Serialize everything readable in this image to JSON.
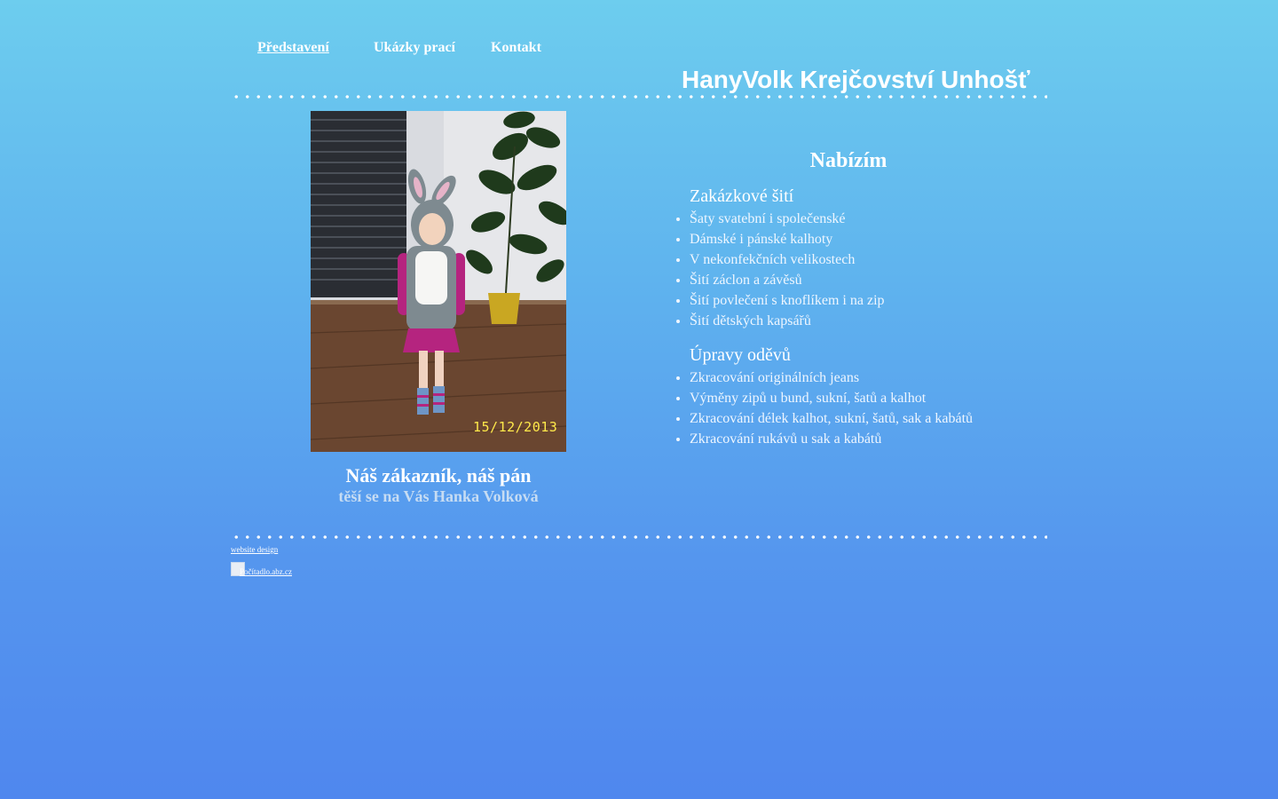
{
  "nav": {
    "items": [
      {
        "label": "Představení",
        "active": true
      },
      {
        "label": "Ukázky prací",
        "active": false
      },
      {
        "label": "Kontakt",
        "active": false
      }
    ]
  },
  "header": {
    "title": "HanyVolk Krejčovství Unhošť"
  },
  "photo": {
    "alt": "Dítě v kostýmu zajíčka",
    "date_stamp": "15/12/2013"
  },
  "caption": {
    "line1": "Náš zákazník, náš pán",
    "line2": "těší se na Vás Hanka Volková"
  },
  "offer": {
    "heading": "Nabízím",
    "sections": [
      {
        "title": "Zakázkové šití",
        "items": [
          "Šaty svatební i společenské",
          "Dámské i pánské kalhoty",
          "V nekonfekčních velikostech",
          "Šití záclon a závěsů",
          "Šití povlečení s knoflíkem i na zip",
          "Šití dětských kapsářů"
        ]
      },
      {
        "title": "Úpravy oděvů",
        "items": [
          "Zkracování originálních jeans",
          "Výměny zipů u bund, sukní, šatů a kalhot",
          "Zkracování délek kalhot, sukní, šatů, sak a kabátů",
          "Zkracování rukávů u sak a kabátů"
        ]
      }
    ]
  },
  "footer": {
    "design_link": "website design",
    "counter_alt": "Počítadlo.abz.cz"
  },
  "colors": {
    "bg_top": "#6dcdee",
    "bg_bottom": "#4f87ee",
    "date_stamp": "#ffe94a",
    "caption_sub": "#c6dcf3"
  }
}
